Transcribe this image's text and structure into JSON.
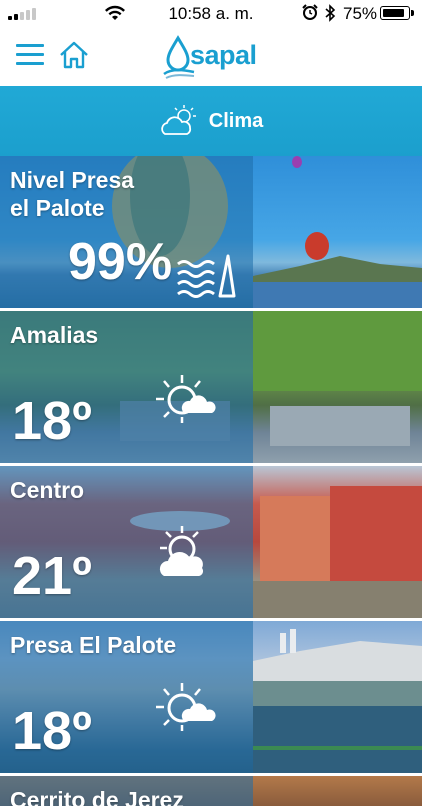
{
  "status_bar": {
    "time": "10:58 a. m.",
    "battery_percent": "75%",
    "battery_level": 0.75,
    "signal_bars": 2
  },
  "header": {
    "brand": "sapal",
    "menu_icon": "hamburger-menu-icon",
    "home_icon": "home-icon"
  },
  "section": {
    "title": "Clima",
    "icon": "partly-cloudy-icon",
    "color": "#1ea5d3"
  },
  "cards": [
    {
      "name": "Nivel Presa\nel Palote",
      "value": "99%",
      "icon": "water-level-icon"
    },
    {
      "name": "Amalias",
      "value": "18º",
      "icon": "partly-sunny-icon"
    },
    {
      "name": "Centro",
      "value": "21º",
      "icon": "sun-behind-cloud-icon"
    },
    {
      "name": "Presa El Palote",
      "value": "18º",
      "icon": "partly-sunny-icon"
    },
    {
      "name": "Cerrito de Jerez",
      "value": "",
      "icon": ""
    }
  ]
}
